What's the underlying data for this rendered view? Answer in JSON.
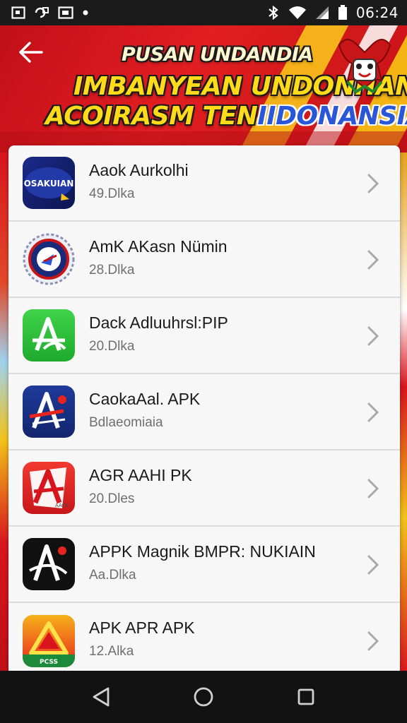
{
  "status_bar": {
    "time": "06:24",
    "left_icons": [
      "screenshot-icon",
      "gallery-icon",
      "photo-icon",
      "dot-icon"
    ],
    "right_icons": [
      "bluetooth-icon",
      "wifi-icon",
      "signal-icon",
      "battery-icon"
    ]
  },
  "banner": {
    "line1": "PUSAN UNDANDIA",
    "line2": "IMBANYEAN UNDONHAN",
    "line3_a": "ACOIRASM TEN",
    "line3_b": "IIDONANSIA",
    "emblem": "garuda-emblem-icon",
    "colors": {
      "red": "#d8141c",
      "yellow": "#ffdb1a",
      "blue": "#2a56d8"
    }
  },
  "apps": [
    {
      "name": "Aaok Aurkolhi",
      "sub": "49.Dlka",
      "icon": "app-icon-blue-logo",
      "icon_text": "OSAKUIAN"
    },
    {
      "name": "AmK AKasn Nümin",
      "sub": "28.Dlka",
      "icon": "app-icon-round-seal"
    },
    {
      "name": "Dack Adluuhrsl:PIP",
      "sub": "20.Dlka",
      "icon": "app-icon-green-a"
    },
    {
      "name": "CaokaAal. APK",
      "sub": "Bdlaeomiaia",
      "icon": "app-icon-navy-a"
    },
    {
      "name": "AGR AAHI PK",
      "sub": "20.Dles",
      "icon": "app-icon-red-a",
      "icon_text": "AACK"
    },
    {
      "name": "APPK Magnik BMPR: NUKIAIN",
      "sub": "Aa.Dlka",
      "icon": "app-icon-black-a"
    },
    {
      "name": "APK APR APK",
      "sub": "12.Alka",
      "icon": "app-icon-triangle",
      "icon_text": "PCSS"
    }
  ],
  "nav": [
    "back-nav-icon",
    "home-nav-icon",
    "recents-nav-icon"
  ]
}
